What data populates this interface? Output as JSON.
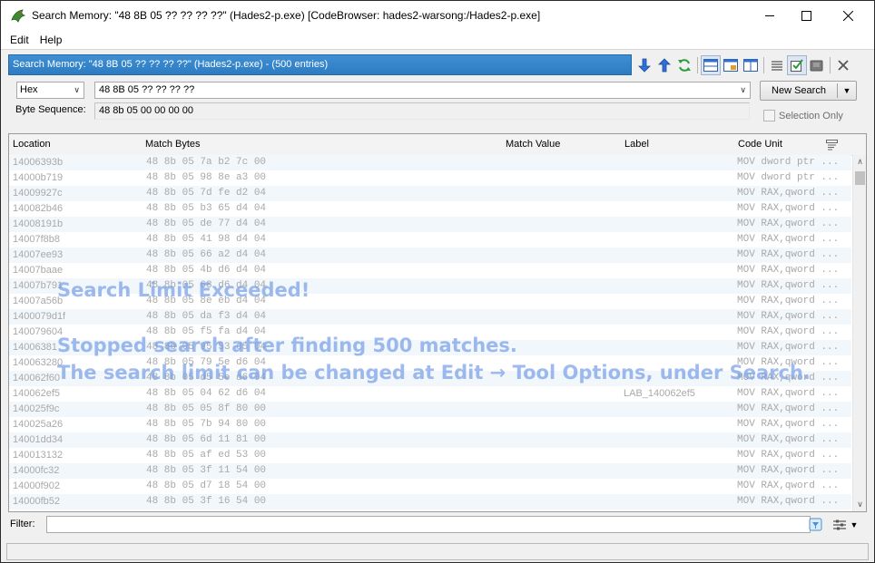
{
  "window": {
    "title": "Search Memory: \"48 8B 05 ?? ?? ?? ??\"  (Hades2-p.exe) [CodeBrowser: hades2-warsong:/Hades2-p.exe]"
  },
  "menu": [
    "Edit",
    "Help"
  ],
  "panel": {
    "title": "Search Memory: \"48 8B 05 ?? ?? ?? ??\"  (Hades2-p.exe) -  (500 entries)",
    "accent": "#3a86cc"
  },
  "search": {
    "format": "Hex",
    "query": "48 8B 05 ?? ?? ?? ??",
    "new_search_label": "New Search",
    "byte_sequence_label": "Byte Sequence:",
    "byte_sequence": "48 8b 05 00 00 00 00",
    "selection_only_label": "Selection Only"
  },
  "table": {
    "columns": [
      "Location",
      "Match Bytes",
      "Match Value",
      "Label",
      "Code Unit"
    ],
    "rows": [
      {
        "location": "14006393b",
        "bytes": "48 8b 05 7a b2 7c 00",
        "label": "",
        "unit": "MOV dword ptr ..."
      },
      {
        "location": "14000b719",
        "bytes": "48 8b 05 98 8e a3 00",
        "label": "",
        "unit": "MOV dword ptr ..."
      },
      {
        "location": "14009927c",
        "bytes": "48 8b 05 7d fe d2 04",
        "label": "",
        "unit": "MOV RAX,qword ..."
      },
      {
        "location": "140082b46",
        "bytes": "48 8b 05 b3 65 d4 04",
        "label": "",
        "unit": "MOV RAX,qword ..."
      },
      {
        "location": "14008191b",
        "bytes": "48 8b 05 de 77 d4 04",
        "label": "",
        "unit": "MOV RAX,qword ..."
      },
      {
        "location": "14007f8b8",
        "bytes": "48 8b 05 41 98 d4 04",
        "label": "",
        "unit": "MOV RAX,qword ..."
      },
      {
        "location": "14007ee93",
        "bytes": "48 8b 05 66 a2 d4 04",
        "label": "",
        "unit": "MOV RAX,qword ..."
      },
      {
        "location": "14007baae",
        "bytes": "48 8b 05 4b d6 d4 04",
        "label": "",
        "unit": "MOV RAX,qword ..."
      },
      {
        "location": "14007b791",
        "bytes": "48 8b 05 68 d6 d4 04",
        "label": "",
        "unit": "MOV RAX,qword ..."
      },
      {
        "location": "14007a56b",
        "bytes": "48 8b 05 8e eb d4 04",
        "label": "",
        "unit": "MOV RAX,qword ..."
      },
      {
        "location": "1400079d1f",
        "bytes": "48 8b 05 da f3 d4 04",
        "label": "",
        "unit": "MOV RAX,qword ..."
      },
      {
        "location": "140079604",
        "bytes": "48 8b 05 f5 fa d4 04",
        "label": "",
        "unit": "MOV RAX,qword ..."
      },
      {
        "location": "14006381",
        "bytes": "48 8b 05 95 53 d5 04",
        "label": "",
        "unit": "MOV RAX,qword ..."
      },
      {
        "location": "140063280",
        "bytes": "48 8b 05 79 5e d6 04",
        "label": "",
        "unit": "MOV RAX,qword ..."
      },
      {
        "location": "140062f60",
        "bytes": "48 8b 05 d5 5e d6 04",
        "label": "",
        "unit": "MOV RAX,qword ..."
      },
      {
        "location": "140062ef5",
        "bytes": "48 8b 05 04 62 d6 04",
        "label": "LAB_140062ef5",
        "unit": "MOV RAX,qword ..."
      },
      {
        "location": "140025f9c",
        "bytes": "48 8b 05 05 8f 80 00",
        "label": "",
        "unit": "MOV RAX,qword ..."
      },
      {
        "location": "140025a26",
        "bytes": "48 8b 05 7b 94 80 00",
        "label": "",
        "unit": "MOV RAX,qword ..."
      },
      {
        "location": "14001dd34",
        "bytes": "48 8b 05 6d 11 81 00",
        "label": "",
        "unit": "MOV RAX,qword ..."
      },
      {
        "location": "140013132",
        "bytes": "48 8b 05 af ed 53 00",
        "label": "",
        "unit": "MOV RAX,qword ..."
      },
      {
        "location": "14000fc32",
        "bytes": "48 8b 05 3f 11 54 00",
        "label": "",
        "unit": "MOV RAX,qword ..."
      },
      {
        "location": "14000f902",
        "bytes": "48 8b 05 d7 18 54 00",
        "label": "",
        "unit": "MOV RAX,qword ..."
      },
      {
        "location": "14000fb52",
        "bytes": "48 8b 05 3f 16 54 00",
        "label": "",
        "unit": "MOV RAX,qword ..."
      }
    ]
  },
  "overlay": {
    "line1": "Search Limit Exceeded!",
    "line2": "Stopped search after finding 500 matches.",
    "line3": "The search limit can be changed at Edit → Tool Options, under Search."
  },
  "filter": {
    "label": "Filter:",
    "value": ""
  }
}
